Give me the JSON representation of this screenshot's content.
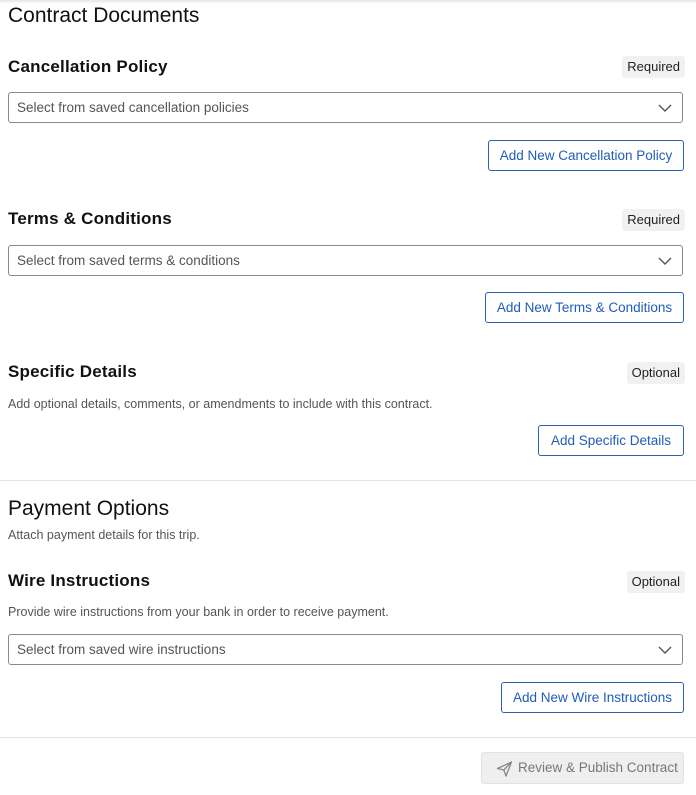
{
  "contract_documents": {
    "title": "Contract Documents",
    "cancellation_policy": {
      "title": "Cancellation Policy",
      "badge": "Required",
      "select_placeholder": "Select from saved cancellation policies",
      "add_button": "Add New Cancellation Policy"
    },
    "terms_conditions": {
      "title": "Terms & Conditions",
      "badge": "Required",
      "select_placeholder": "Select from saved terms & conditions",
      "add_button": "Add New Terms & Conditions"
    },
    "specific_details": {
      "title": "Specific Details",
      "badge": "Optional",
      "description": "Add optional details, comments, or amendments to include with this contract.",
      "add_button": "Add Specific Details"
    }
  },
  "payment_options": {
    "title": "Payment Options",
    "description": "Attach payment details for this trip.",
    "wire_instructions": {
      "title": "Wire Instructions",
      "badge": "Optional",
      "description": "Provide wire instructions from your bank in order to receive payment.",
      "select_placeholder": "Select from saved wire instructions",
      "add_button": "Add New Wire Instructions"
    }
  },
  "footer": {
    "publish_button": "Review & Publish Contract",
    "publish_icon": "paper-plane-icon"
  },
  "colors": {
    "accent": "#1f5db8",
    "border": "#8a8a8a",
    "badge_bg": "#f1f1f1",
    "disabled_bg": "#efefef"
  }
}
